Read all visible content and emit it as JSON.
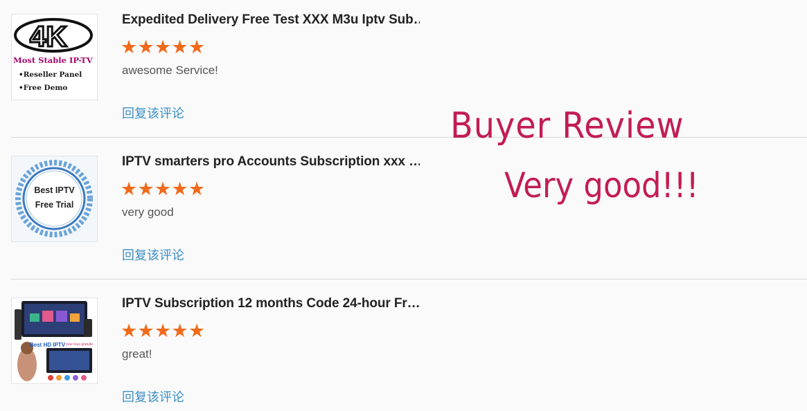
{
  "reviews": [
    {
      "title": "Expedited Delivery Free Test XXX M3u Iptv Sub…",
      "rating": 5,
      "comment": "awesome Service!",
      "reply_label": "回复该评论",
      "thumbnail": {
        "logo_text": "4K",
        "line1": "Most Stable IP-TV",
        "line2": "•Reseller Panel",
        "line3": "•Free Demo"
      }
    },
    {
      "title": "IPTV smarters pro Accounts Subscription xxx …",
      "rating": 5,
      "comment": "very good",
      "reply_label": "回复该评论",
      "thumbnail": {
        "line1": "Best IPTV",
        "line2": "Free Trial"
      }
    },
    {
      "title": "IPTV Subscription 12 months Code 24-hour Fr…",
      "rating": 5,
      "comment": "great!",
      "reply_label": "回复该评论",
      "thumbnail": {
        "label": "Best HD IPTV",
        "sublabel": "pour tous gratuite"
      }
    }
  ],
  "overlay": {
    "line1": "Buyer  Review",
    "line2": "Very good!!!"
  },
  "colors": {
    "star": "#f26a1b",
    "reply_link": "#3a8fc6",
    "overlay_text": "#c21d53"
  },
  "icons": {
    "star": "star-icon"
  }
}
